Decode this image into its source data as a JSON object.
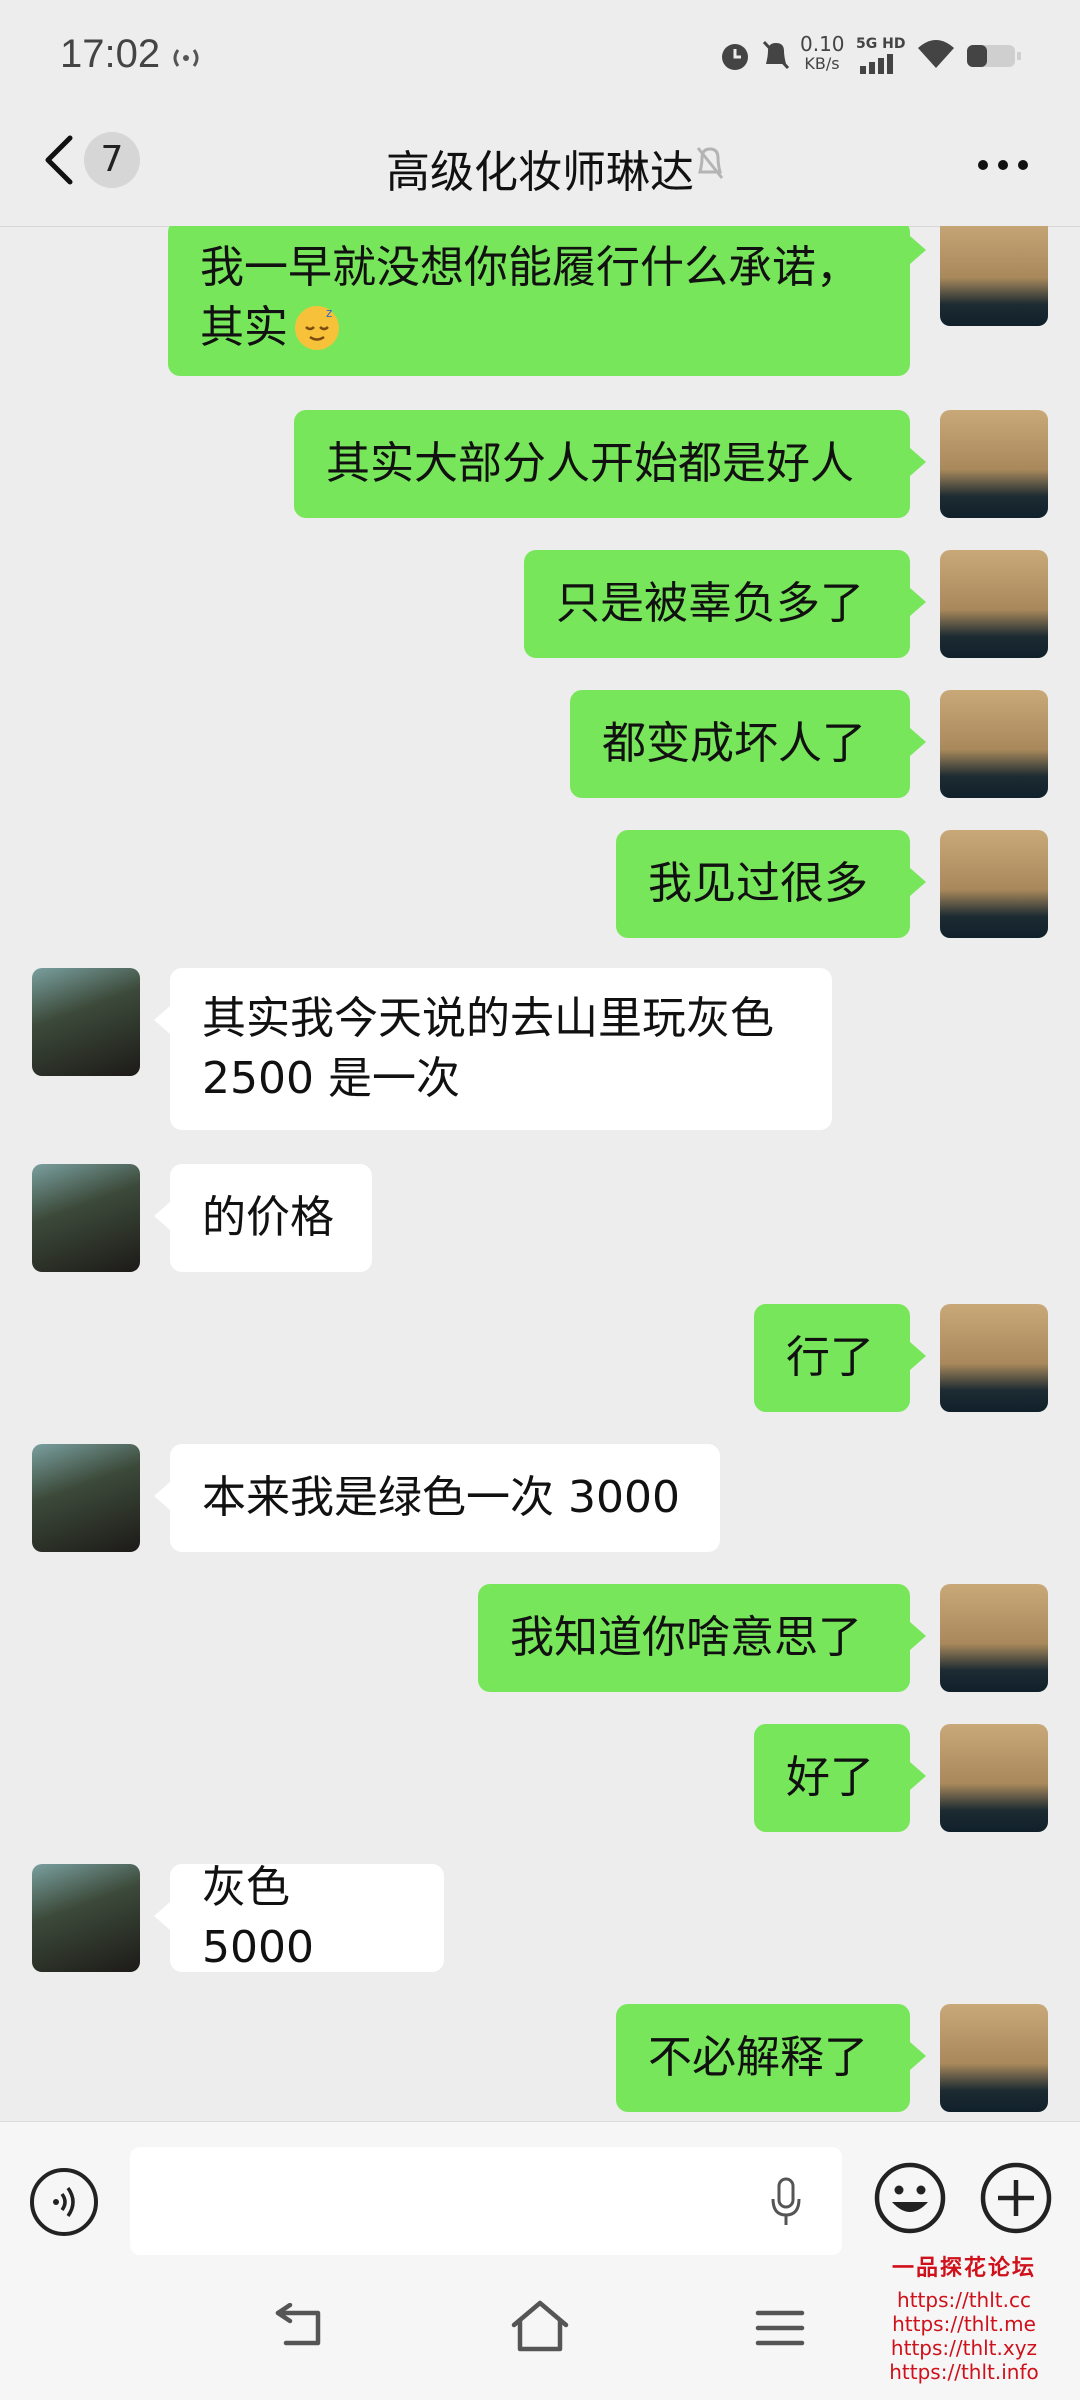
{
  "status": {
    "time": "17:02",
    "net_speed_value": "0.10",
    "net_speed_unit": "KB/s",
    "net_type": "5G HD"
  },
  "header": {
    "unread_count": "7",
    "title": "高级化妆师琳达"
  },
  "messages": [
    {
      "from": "self",
      "lines": [
        "我一早就没想你能履行什么承诺，",
        "其实"
      ],
      "emoji": "sleepy-face"
    },
    {
      "from": "self",
      "lines": [
        "其实大部分人开始都是好人"
      ]
    },
    {
      "from": "self",
      "lines": [
        "只是被辜负多了"
      ]
    },
    {
      "from": "self",
      "lines": [
        "都变成坏人了"
      ]
    },
    {
      "from": "self",
      "lines": [
        "我见过很多"
      ]
    },
    {
      "from": "other",
      "lines": [
        "其实我今天说的去山里玩灰色",
        "2500 是一次"
      ]
    },
    {
      "from": "other",
      "lines": [
        "的价格"
      ]
    },
    {
      "from": "self",
      "lines": [
        "行了"
      ]
    },
    {
      "from": "other",
      "lines": [
        "本来我是绿色一次 3000"
      ]
    },
    {
      "from": "self",
      "lines": [
        "我知道你啥意思了"
      ]
    },
    {
      "from": "self",
      "lines": [
        "好了"
      ]
    },
    {
      "from": "other",
      "lines": [
        "灰色 5000"
      ]
    },
    {
      "from": "self",
      "lines": [
        "不必解释了"
      ]
    }
  ],
  "watermark": {
    "title": "一品探花论坛",
    "links": [
      "https://thlt.cc",
      "https://thlt.me",
      "https://thlt.xyz",
      "https://thlt.info"
    ]
  },
  "colors": {
    "self_bubble": "#78e65a",
    "other_bubble": "#ffffff",
    "background": "#ededed",
    "watermark": "#d0101a"
  },
  "icons": [
    "back-chevron-icon",
    "mute-bell-icon",
    "more-icon",
    "voice-icon",
    "microphone-icon",
    "emoji-icon",
    "plus-icon",
    "nav-back-icon",
    "nav-home-icon",
    "nav-menu-icon"
  ]
}
